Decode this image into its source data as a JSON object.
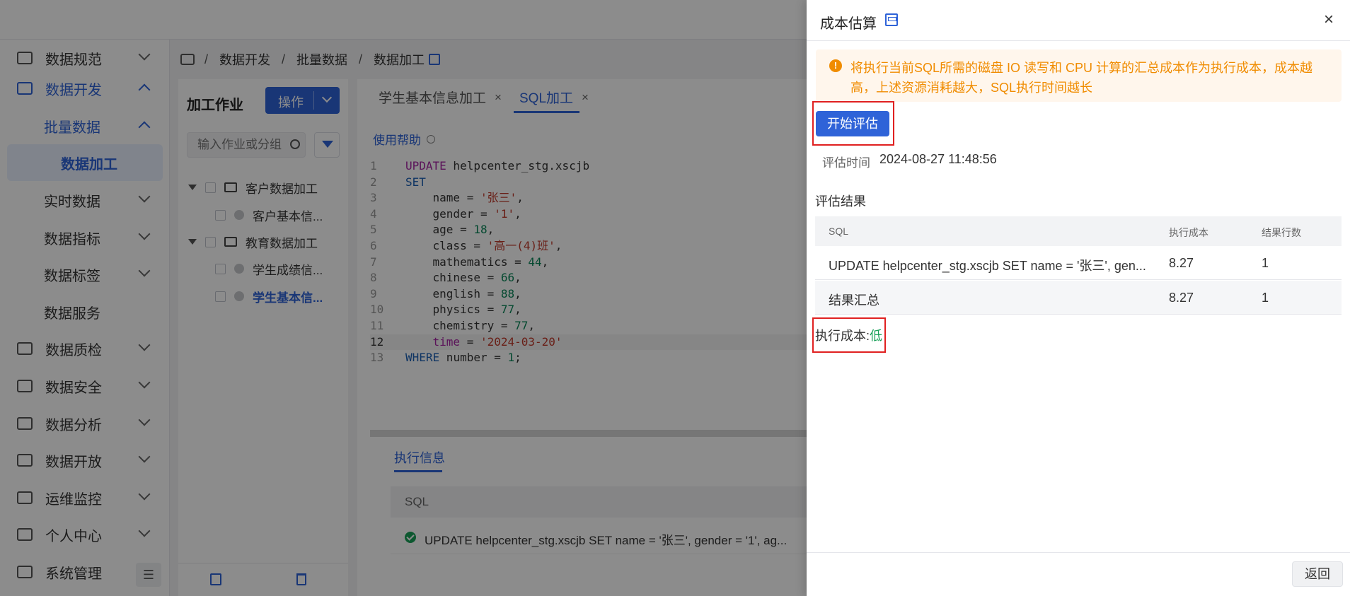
{
  "sidebar": {
    "items": [
      {
        "label": "数据规范"
      },
      {
        "label": "数据开发"
      },
      {
        "label": "批量数据"
      },
      {
        "label": "数据加工"
      },
      {
        "label": "实时数据"
      },
      {
        "label": "数据指标"
      },
      {
        "label": "数据标签"
      },
      {
        "label": "数据服务"
      },
      {
        "label": "数据质检"
      },
      {
        "label": "数据安全"
      },
      {
        "label": "数据分析"
      },
      {
        "label": "数据开放"
      },
      {
        "label": "运维监控"
      },
      {
        "label": "个人中心"
      },
      {
        "label": "系统管理"
      }
    ]
  },
  "breadcrumb": {
    "items": [
      "数据开发",
      "批量数据",
      "数据加工"
    ],
    "separator": "/"
  },
  "jobs": {
    "title": "加工作业",
    "op_button": "操作",
    "search_placeholder": "输入作业或分组",
    "tree": [
      {
        "label": "客户数据加工"
      },
      {
        "label": "客户基本信..."
      },
      {
        "label": "教育数据加工"
      },
      {
        "label": "学生成绩信..."
      },
      {
        "label": "学生基本信..."
      }
    ]
  },
  "editor": {
    "tabs": [
      {
        "label": "学生基本信息加工",
        "close": "×"
      },
      {
        "label": "SQL加工",
        "close": "×"
      }
    ],
    "help_link": "使用帮助",
    "line_numbers": [
      "1",
      "2",
      "3",
      "4",
      "5",
      "6",
      "7",
      "8",
      "9",
      "10",
      "11",
      "12",
      "13"
    ],
    "exec_tab": "执行信息",
    "exec_header": "SQL",
    "exec_row": "UPDATE helpcenter_stg.xscjb SET name = '张三', gender = '1', ag..."
  },
  "drawer": {
    "title": "成本估算",
    "close": "×",
    "alert_icon": "!",
    "alert_text": "将执行当前SQL所需的磁盘 IO 读写和 CPU 计算的汇总成本作为执行成本，成本越高，上述资源消耗越大，SQL执行时间越长",
    "start_button": "开始评估",
    "time_label": "评估时间",
    "time_value": "2024-08-27 11:48:56",
    "result_label": "评估结果",
    "table": {
      "headers": [
        "SQL",
        "执行成本",
        "结果行数"
      ],
      "rows": [
        [
          "UPDATE helpcenter_stg.xscjb SET name = '张三', gen...",
          "8.27",
          "1"
        ],
        [
          "结果汇总",
          "8.27",
          "1"
        ]
      ]
    },
    "cost_label": "执行成本:",
    "cost_value": "低",
    "back_button": "返回"
  },
  "colors": {
    "primary": "#2f63d8",
    "warning": "#f08c00",
    "success": "#18a058",
    "highlight_box": "#e02020"
  },
  "icons": [
    "shield-icon",
    "code-icon",
    "chevron-icon",
    "box-icon",
    "search-icon",
    "filter-icon",
    "folder-icon",
    "edit-icon",
    "trash-icon",
    "close-icon",
    "warning-icon",
    "check-icon",
    "collapse-icon"
  ]
}
